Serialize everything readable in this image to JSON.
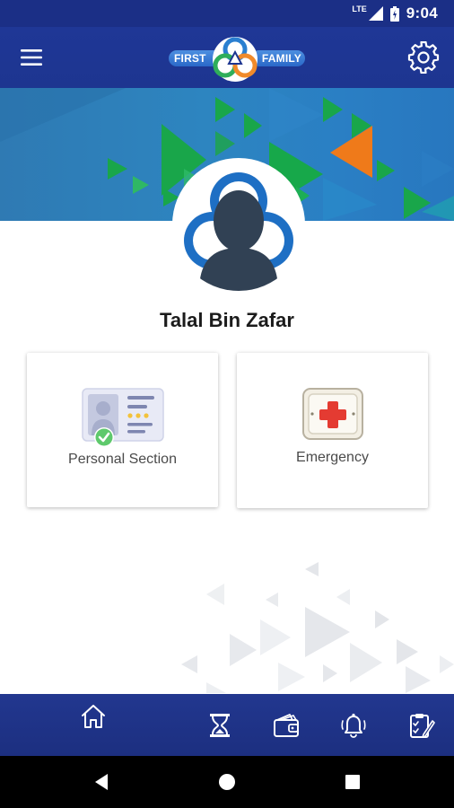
{
  "status_bar": {
    "network_label": "LTE",
    "time": "9:04",
    "icons": [
      "signal-icon",
      "battery-icon"
    ]
  },
  "app_bar": {
    "brand_left": "FIRST",
    "brand_right": "FAMILY",
    "icons": [
      "hamburger-menu-icon",
      "gear-icon"
    ]
  },
  "profile": {
    "name": "Talal Bin Zafar"
  },
  "cards": [
    {
      "label": "Personal Section",
      "icon": "id-card-check-icon"
    },
    {
      "label": "Emergency",
      "icon": "first-aid-kit-icon"
    }
  ],
  "bottom_nav": {
    "items": [
      "home-icon",
      "hourglass-icon",
      "wallet-icon",
      "bell-icon",
      "clipboard-edit-icon"
    ]
  },
  "system_nav": {
    "items": [
      "back-icon",
      "home-circle-icon",
      "recents-icon"
    ]
  },
  "colors": {
    "primary": "#1d3590",
    "banner_blue": "#2d85c0",
    "accent_green": "#17a84a",
    "accent_orange": "#ef7a1a",
    "avatar_blue": "#1e6fc4",
    "avatar_silhouette": "#314154",
    "check_green": "#5ec96c",
    "cross_red": "#e43b32"
  }
}
